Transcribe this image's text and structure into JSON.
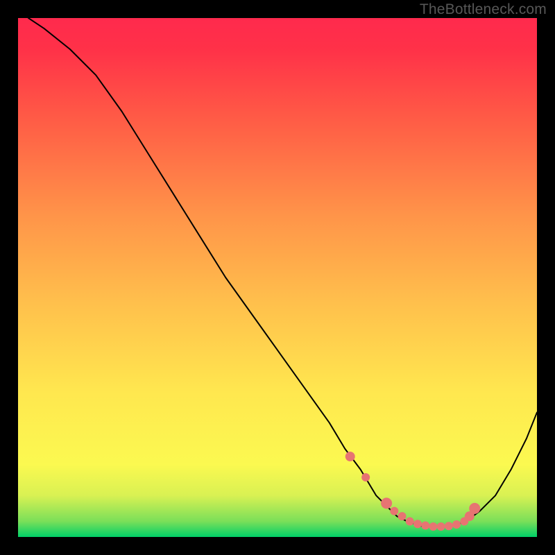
{
  "watermark": "TheBottleneck.com",
  "chart_data": {
    "type": "line",
    "title": "",
    "xlabel": "",
    "ylabel": "",
    "xlim": [
      0,
      100
    ],
    "ylim": [
      0,
      100
    ],
    "gradient_stops": [
      {
        "offset": 0.0,
        "color": "#00d068"
      },
      {
        "offset": 0.03,
        "color": "#7adf59"
      },
      {
        "offset": 0.08,
        "color": "#d9f153"
      },
      {
        "offset": 0.14,
        "color": "#fbf950"
      },
      {
        "offset": 0.28,
        "color": "#ffe74f"
      },
      {
        "offset": 0.45,
        "color": "#ffc04c"
      },
      {
        "offset": 0.62,
        "color": "#ff9449"
      },
      {
        "offset": 0.8,
        "color": "#ff5d46"
      },
      {
        "offset": 0.94,
        "color": "#ff3148"
      },
      {
        "offset": 1.0,
        "color": "#ff2a4d"
      }
    ],
    "series": [
      {
        "name": "curve",
        "x": [
          2,
          5,
          10,
          15,
          20,
          25,
          30,
          35,
          40,
          45,
          50,
          55,
          60,
          63,
          66,
          69,
          71,
          73,
          75,
          78,
          81,
          83,
          85,
          87,
          89,
          92,
          95,
          98,
          100
        ],
        "y": [
          100,
          98,
          94,
          89,
          82,
          74,
          66,
          58,
          50,
          43,
          36,
          29,
          22,
          17,
          13,
          8,
          6,
          4,
          3,
          2,
          2,
          2,
          2.5,
          3.5,
          5,
          8,
          13,
          19,
          24
        ]
      }
    ],
    "markers": {
      "x": [
        64,
        67,
        71,
        72.5,
        74,
        75.5,
        77,
        78.5,
        80,
        81.5,
        83,
        84.5,
        86,
        87,
        88
      ],
      "y": [
        15.5,
        11.5,
        6.5,
        5,
        4,
        3,
        2.5,
        2.2,
        2,
        2,
        2.1,
        2.4,
        3,
        4,
        5.5
      ],
      "size": [
        7,
        6,
        8,
        6,
        6,
        6,
        6,
        6,
        6,
        6,
        6,
        6,
        6,
        7,
        8
      ],
      "color": "#e77472"
    }
  }
}
